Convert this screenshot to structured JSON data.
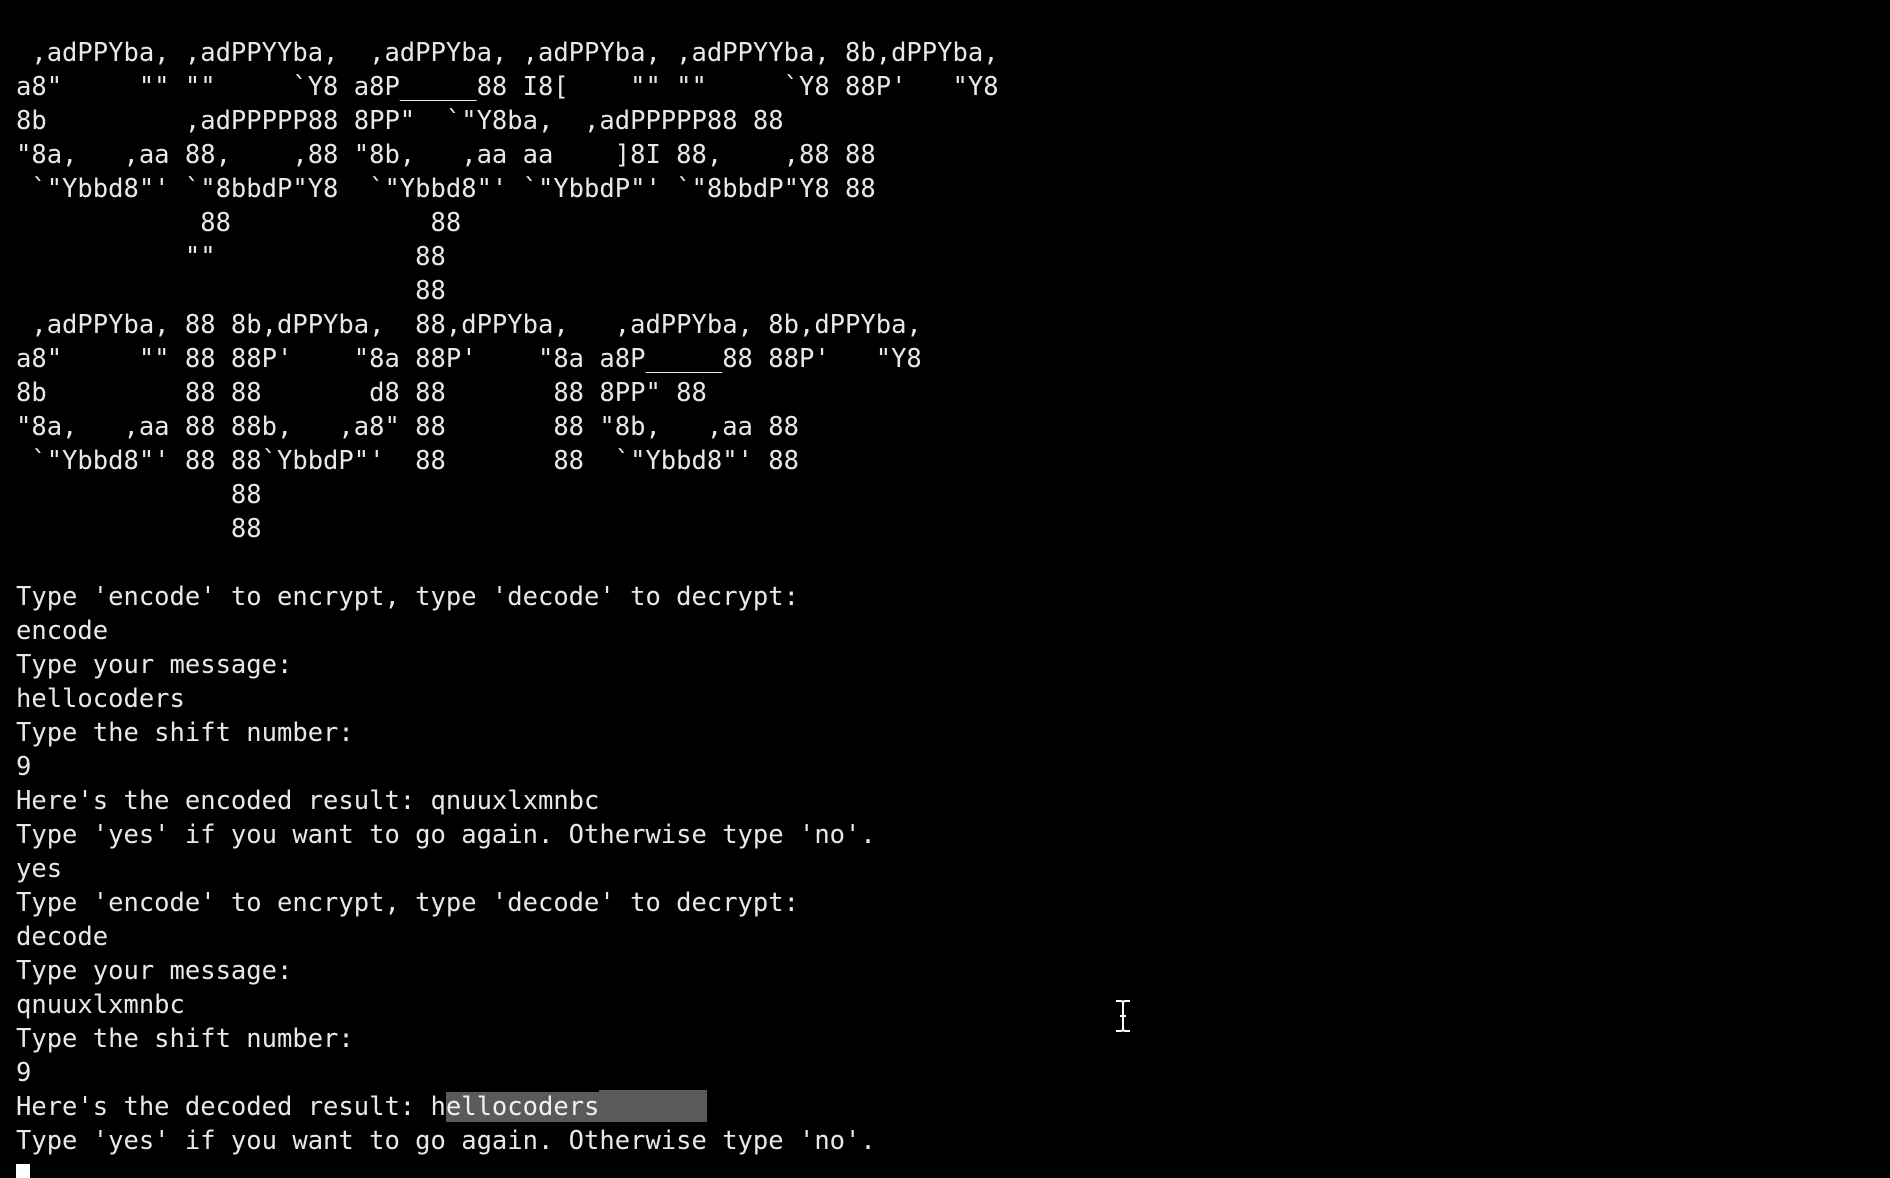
{
  "window": {
    "colors": {
      "background": "#000000",
      "text": "#e8e8e8",
      "selection": "#5a5a5a"
    }
  },
  "banner": {
    "lines": [
      " ,adPPYba, ,adPPYYba,  ,adPPYba, ,adPPYba, ,adPPYYba, 8b,dPPYba,",
      "a8\"     \"\" \"\"     `Y8 a8P_____88 I8[    \"\" \"\"     `Y8 88P'   \"Y8",
      "8b         ,adPPPPP88 8PP\"  `\"Y8ba,  ,adPPPPP88 88",
      "\"8a,   ,aa 88,    ,88 \"8b,   ,aa aa    ]8I 88,    ,88 88",
      " `\"Ybbd8\"' `\"8bbdP\"Y8  `\"Ybbd8\"' `\"YbbdP\"' `\"8bbdP\"Y8 88",
      "            88             88",
      "           \"\"             88",
      "                          88",
      " ,adPPYba, 88 8b,dPPYba,  88,dPPYba,   ,adPPYba, 8b,dPPYba,",
      "a8\"     \"\" 88 88P'    \"8a 88P'    \"8a a8P_____88 88P'   \"Y8",
      "8b         88 88       d8 88       88 8PP\" 88",
      "\"8a,   ,aa 88 88b,   ,a8\" 88       88 \"8b,   ,aa 88",
      " `\"Ybbd8\"' 88 88`YbbdP\"'  88       88  `\"Ybbd8\"' 88",
      "              88",
      "              88"
    ]
  },
  "session": {
    "prompt_mode": "Type 'encode' to encrypt, type 'decode' to decrypt:",
    "input_mode_1": "encode",
    "prompt_message": "Type your message:",
    "input_message_1": "hellocoders",
    "prompt_shift": "Type the shift number:",
    "input_shift_1": "9",
    "result_encoded": "Here's the encoded result: qnuuxlxmnbc",
    "prompt_again": "Type 'yes' if you want to go again. Otherwise type 'no'.",
    "input_again_1": "yes",
    "input_mode_2": "decode",
    "input_message_2": "qnuuxlxmnbc",
    "input_shift_2": "9",
    "result_decoded_prefix": "Here's the decoded result: h",
    "result_decoded_selected": "ellocoders"
  },
  "icons": {
    "cursor": "block-cursor-icon",
    "pointer": "text-ibeam-icon"
  }
}
